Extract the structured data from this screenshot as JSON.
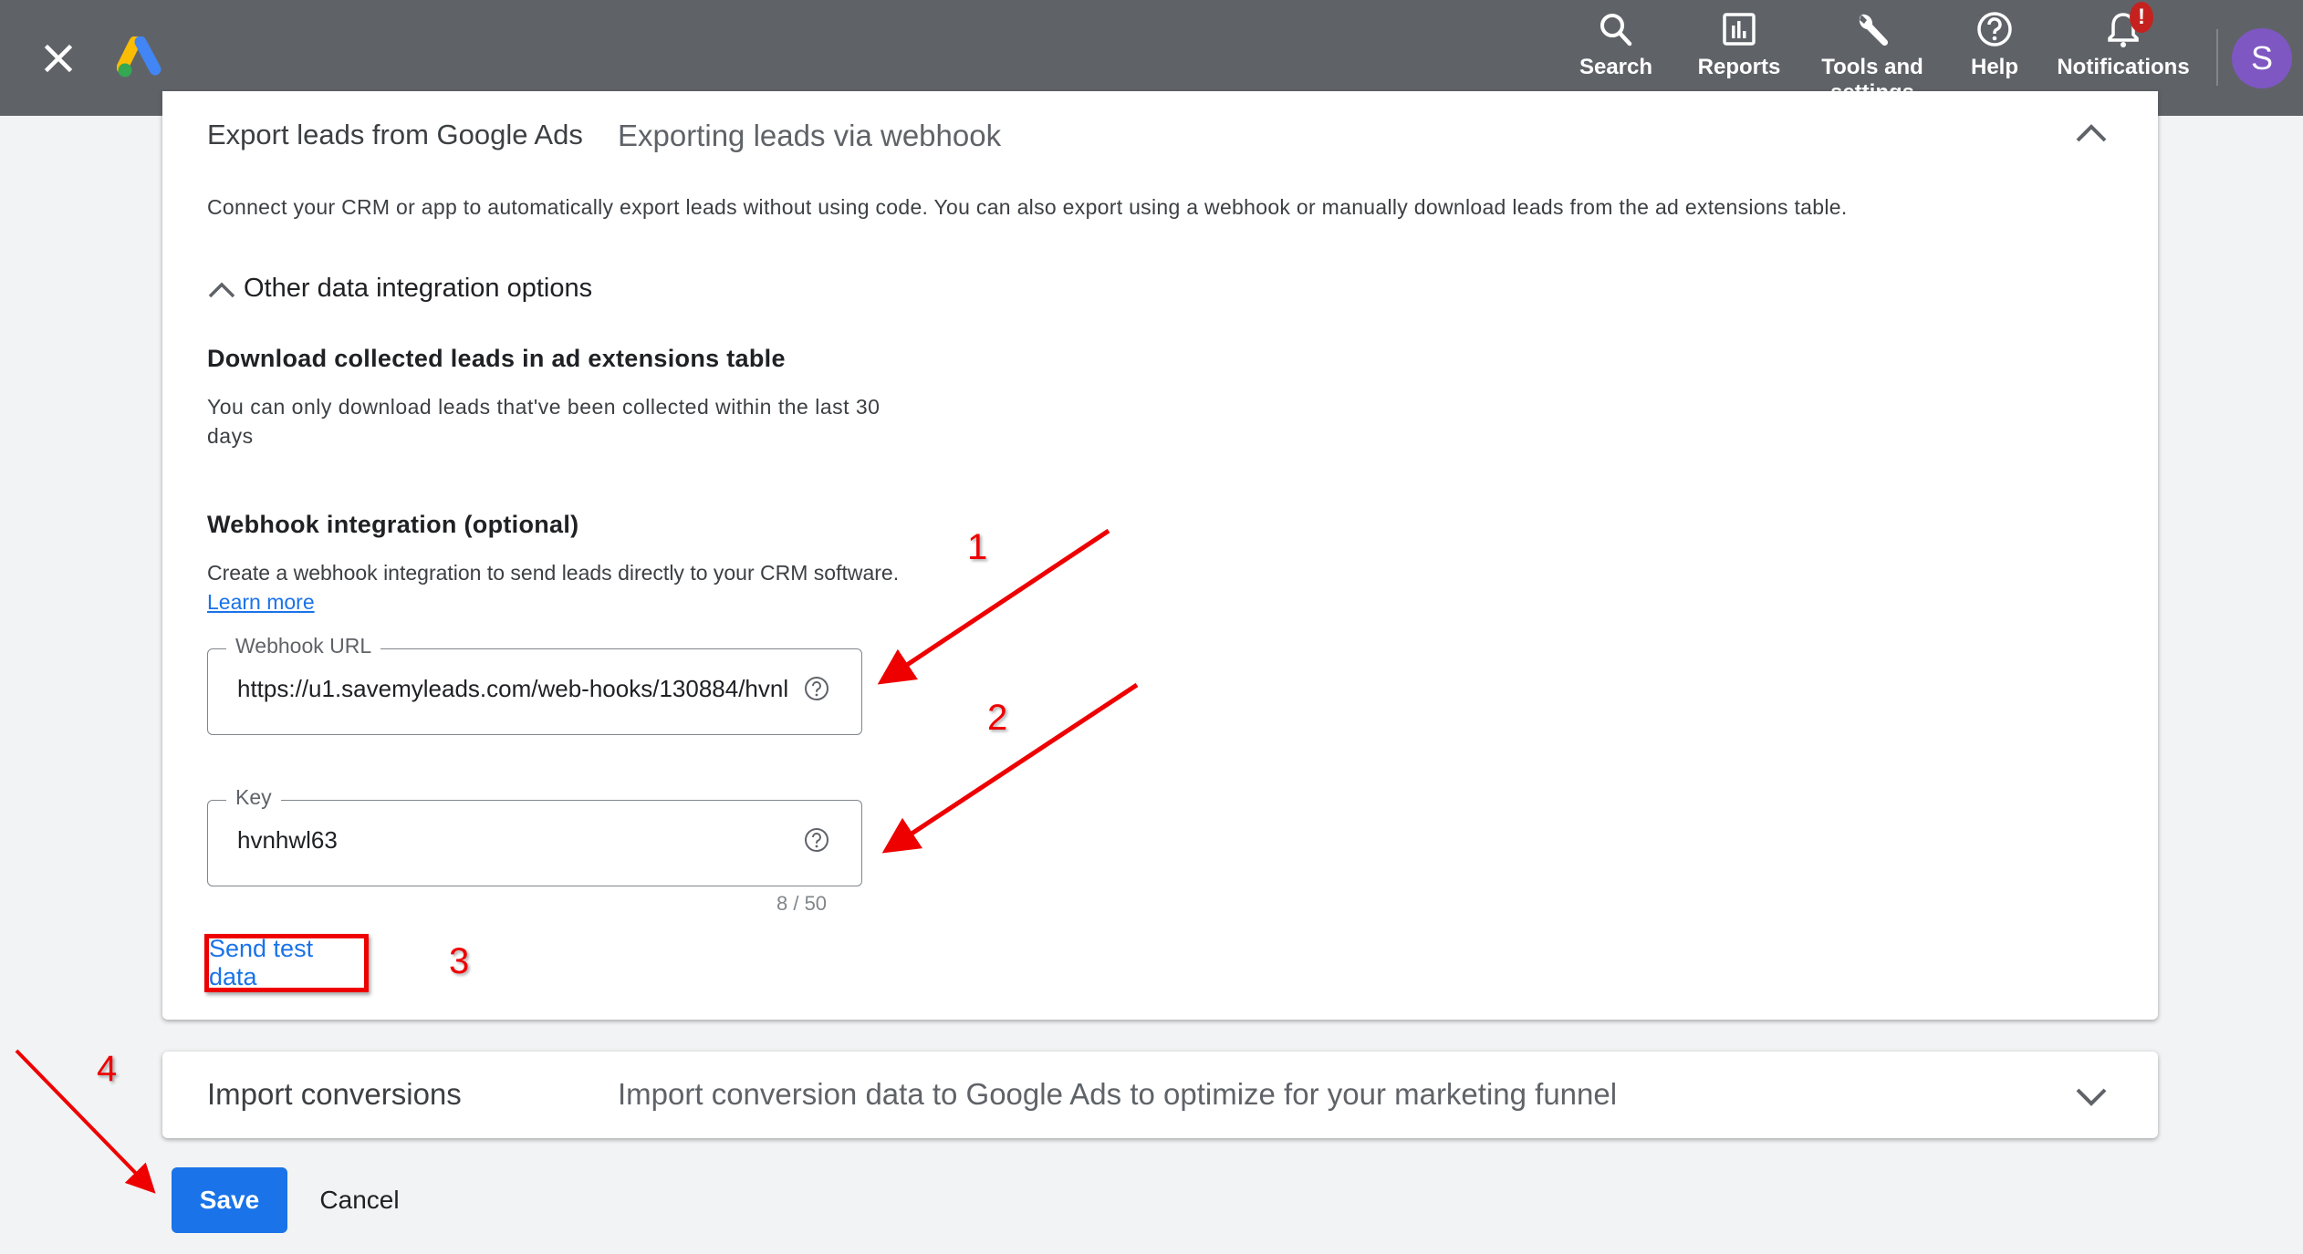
{
  "topbar": {
    "nav": [
      {
        "id": "search",
        "label": "Search",
        "icon": "search-icon"
      },
      {
        "id": "reports",
        "label": "Reports",
        "icon": "reports-icon"
      },
      {
        "id": "tools",
        "label": "Tools and settings",
        "icon": "wrench-icon"
      },
      {
        "id": "help",
        "label": "Help",
        "icon": "help-icon"
      },
      {
        "id": "notifications",
        "label": "Notifications",
        "icon": "bell-icon",
        "badge": "!"
      }
    ],
    "avatar_initial": "S",
    "colors": {
      "bar": "#5f6368",
      "avatar": "#7e57c2",
      "badge": "#c5221f"
    }
  },
  "export_card": {
    "title": "Export leads from Google Ads",
    "subtitle": "Exporting leads via webhook",
    "description": "Connect your CRM or app to automatically export leads without using code. You can also export using a webhook or manually download leads from the ad extensions table.",
    "other_options_label": "Other data integration options",
    "download": {
      "title": "Download collected leads in ad extensions table",
      "body": "You can only download leads that've been collected within the last 30 days"
    },
    "webhook": {
      "title": "Webhook integration (optional)",
      "body": "Create a webhook integration to send leads directly to your CRM software.",
      "learn_more": "Learn more",
      "url_label": "Webhook URL",
      "url_value": "https://u1.savemyleads.com/web-hooks/130884/hvnl",
      "key_label": "Key",
      "key_value": "hvnhwl63",
      "key_counter": "8 / 50",
      "send_test": "Send test data"
    }
  },
  "import_card": {
    "title": "Import conversions",
    "subtitle": "Import conversion data to Google Ads to optimize for your marketing funnel"
  },
  "actions": {
    "save": "Save",
    "cancel": "Cancel"
  },
  "annotations": [
    "1",
    "2",
    "3",
    "4"
  ],
  "accent_color": "#1a73e8",
  "annotation_color": "#ee0000"
}
